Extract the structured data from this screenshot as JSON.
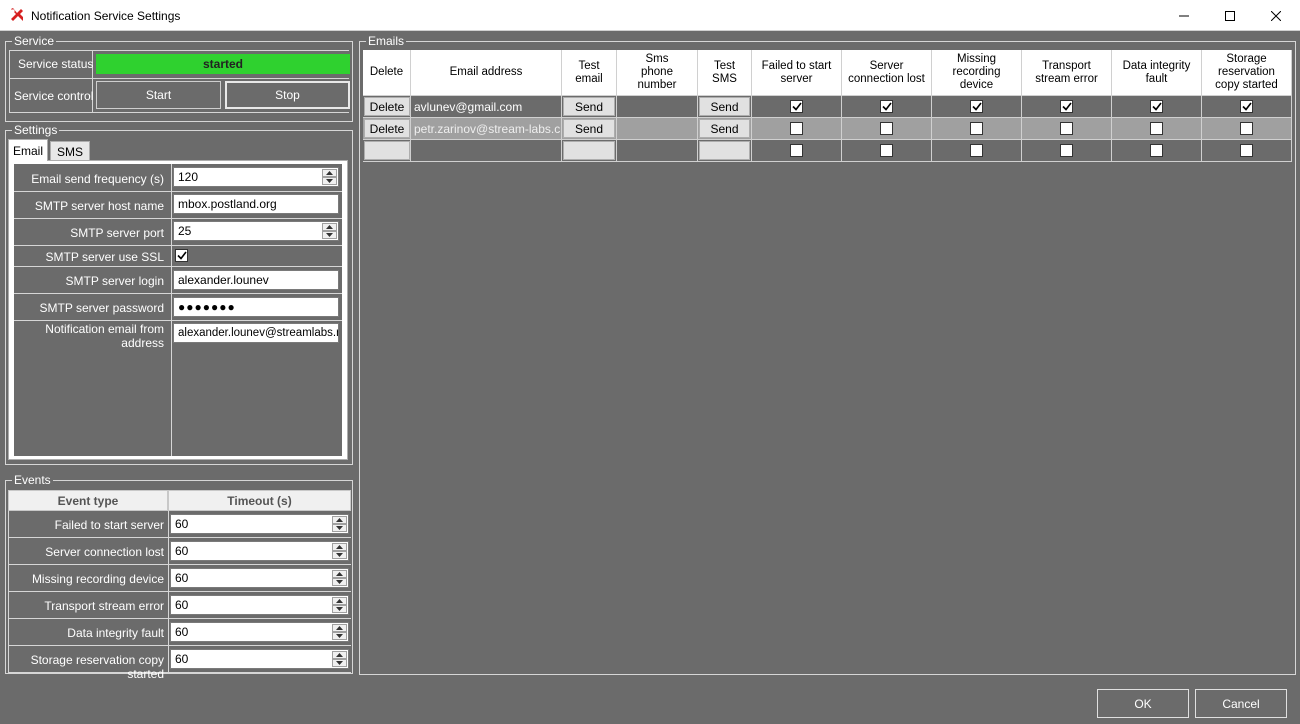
{
  "window": {
    "title": "Notification Service Settings",
    "controls": {
      "minimize": "minimize-icon",
      "maximize": "maximize-icon",
      "close": "close-icon"
    }
  },
  "service": {
    "legend": "Service",
    "status_label": "Service status",
    "status_value": "started",
    "status_color": "#2fd12f",
    "control_label": "Service control",
    "start_label": "Start",
    "stop_label": "Stop"
  },
  "settings": {
    "legend": "Settings",
    "tabs": [
      "Email",
      "SMS"
    ],
    "active_tab": "Email",
    "fields": {
      "send_frequency": {
        "label": "Email send frequency (s)",
        "value": "120"
      },
      "smtp_host": {
        "label": "SMTP server host name",
        "value": "mbox.postland.org"
      },
      "smtp_port": {
        "label": "SMTP server port",
        "value": "25"
      },
      "smtp_ssl": {
        "label": "SMTP server use SSL",
        "checked": true
      },
      "smtp_login": {
        "label": "SMTP server login",
        "value": "alexander.lounev"
      },
      "smtp_password": {
        "label": "SMTP server password",
        "value": "●●●●●●●"
      },
      "from_address": {
        "label": "Notification email from address",
        "value": "alexander.lounev@streamlabs.ru"
      }
    }
  },
  "events": {
    "legend": "Events",
    "col_event_type": "Event type",
    "col_timeout": "Timeout  (s)",
    "rows": [
      {
        "name": "Failed to start server",
        "timeout": "60"
      },
      {
        "name": "Server connection lost",
        "timeout": "60"
      },
      {
        "name": "Missing recording device",
        "timeout": "60"
      },
      {
        "name": "Transport stream error",
        "timeout": "60"
      },
      {
        "name": "Data integrity fault",
        "timeout": "60"
      },
      {
        "name": "Storage reservation copy started",
        "timeout": "60"
      }
    ]
  },
  "emails": {
    "legend": "Emails",
    "columns": {
      "delete": "Delete",
      "email": "Email address",
      "test_email": "Test\nemail",
      "sms_phone": "Sms\nphone\nnumber",
      "test_sms": "Test\nSMS",
      "failed_start": "Failed to start\nserver",
      "conn_lost": "Server\nconnection lost",
      "missing_device": "Missing\nrecording\ndevice",
      "ts_error": "Transport\nstream error",
      "integrity": "Data integrity\nfault",
      "storage": "Storage\nreservation\ncopy started"
    },
    "delete_label": "Delete",
    "send_label": "Send",
    "rows": [
      {
        "email": "avlunev@gmail.com",
        "phone": "",
        "checks": [
          true,
          true,
          true,
          true,
          true,
          true
        ]
      },
      {
        "email": "petr.zarinov@stream-labs.com",
        "phone": "",
        "checks": [
          false,
          false,
          false,
          false,
          false,
          false
        ]
      },
      {
        "email": "",
        "phone": "",
        "checks": [
          false,
          false,
          false,
          false,
          false,
          false
        ]
      }
    ]
  },
  "footer": {
    "ok_label": "OK",
    "cancel_label": "Cancel"
  }
}
